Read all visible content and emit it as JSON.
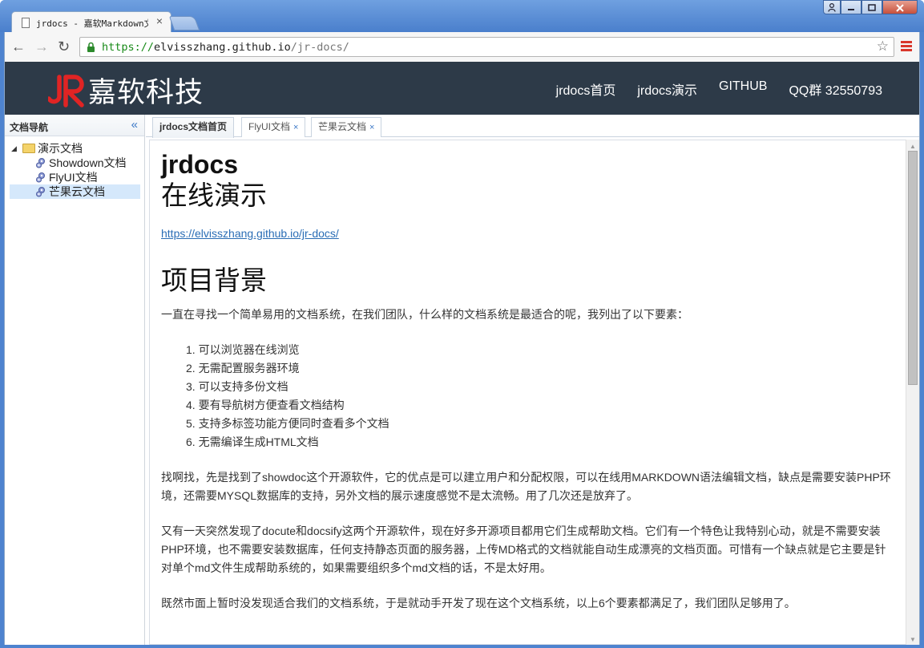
{
  "browser": {
    "tab_title": "jrdocs - 嘉软Markdown文档",
    "tab_close": "×",
    "url_scheme": "https://",
    "url_host": "elvisszhang.github.io",
    "url_path": "/jr-docs/",
    "nav": {
      "back": "←",
      "forward": "→",
      "reload": "↻"
    },
    "star": "☆",
    "window_buttons": {
      "user": "👤",
      "minimize": "▁",
      "maximize": "▢",
      "close": "✕"
    }
  },
  "header": {
    "logo_text": "嘉软科技",
    "nav": [
      "jrdocs首页",
      "jrdocs演示",
      "GITHUB",
      "QQ群 32550793"
    ]
  },
  "sidebar": {
    "title": "文档导航",
    "collapse": "«",
    "tree": {
      "root": "演示文档",
      "children": [
        "Showdown文档",
        "FlyUI文档",
        "芒果云文档"
      ],
      "selected_index": 2
    }
  },
  "page_tabs": [
    {
      "label": "jrdocs文档首页",
      "closable": false
    },
    {
      "label": "FlyUI文档",
      "closable": true
    },
    {
      "label": "芒果云文档",
      "closable": true
    }
  ],
  "tab_close_glyph": "×",
  "doc": {
    "title": "jrdocs",
    "section1": "在线演示",
    "link": "https://elvisszhang.github.io/jr-docs/",
    "section2": "项目背景",
    "intro": "一直在寻找一个简单易用的文档系统，在我们团队，什么样的文档系统是最适合的呢，我列出了以下要素：",
    "requirements": [
      "1. 可以浏览器在线浏览",
      "2. 无需配置服务器环境",
      "3. 可以支持多份文档",
      "4. 要有导航树方便查看文档结构",
      "5. 支持多标签功能方便同时查看多个文档",
      "6. 无需编译生成HTML文档"
    ],
    "para1": "找啊找，先是找到了showdoc这个开源软件，它的优点是可以建立用户和分配权限，可以在线用MARKDOWN语法编辑文档，缺点是需要安装PHP环境，还需要MYSQL数据库的支持，另外文档的展示速度感觉不是太流畅。用了几次还是放弃了。",
    "para2": "又有一天突然发现了docute和docsify这两个开源软件，现在好多开源项目都用它们生成帮助文档。它们有一个特色让我特别心动，就是不需要安装PHP环境，也不需要安装数据库，任何支持静态页面的服务器，上传MD格式的文档就能自动生成漂亮的文档页面。可惜有一个缺点就是它主要是针对单个md文件生成帮助系统的，如果需要组织多个md文档的话，不是太好用。",
    "para3": "既然市面上暂时没发现适合我们的文档系统，于是就动手开发了现在这个文档系统，以上6个要素都满足了，我们团队足够用了。"
  },
  "colors": {
    "header_bg": "#2d3a48",
    "logo_red": "#e02424",
    "link": "#2a6db5",
    "tree_selected": "#d5e8fb",
    "window_frame": "#4e83cf"
  }
}
